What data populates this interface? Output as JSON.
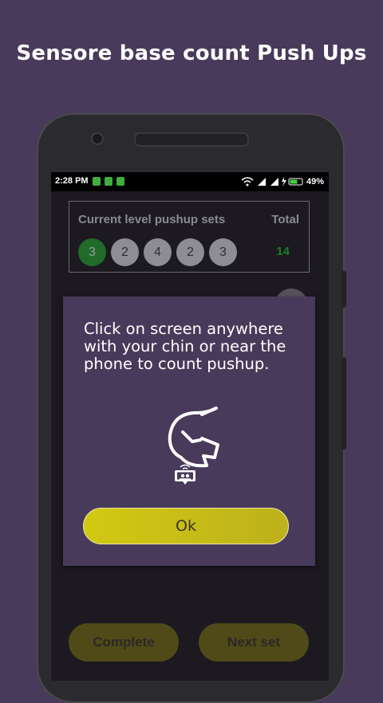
{
  "headline": "Sensore base count Push Ups",
  "status_bar": {
    "time": "2:28 PM",
    "battery_percent": "49%",
    "icons": [
      "wifi-icon",
      "signal-icon",
      "signal-icon",
      "charging-icon",
      "battery-icon"
    ]
  },
  "level": {
    "title": "Current level pushup sets",
    "total_label": "Total",
    "total_value": "14",
    "sets": [
      {
        "value": "3",
        "current": true
      },
      {
        "value": "2",
        "current": false
      },
      {
        "value": "4",
        "current": false
      },
      {
        "value": "2",
        "current": false
      },
      {
        "value": "3",
        "current": false
      }
    ]
  },
  "dialog": {
    "message": "Click on screen anywhere with your chin or near the phone to count pushup.",
    "ok_label": "Ok",
    "icon": "chin-tap-phone-icon"
  },
  "buttons": {
    "complete_label": "Complete",
    "next_set_label": "Next set"
  },
  "colors": {
    "background": "#483a5a",
    "current_set": "#1f6b27",
    "total_value": "#1e7a2b",
    "ok_button": "#d2c912"
  }
}
